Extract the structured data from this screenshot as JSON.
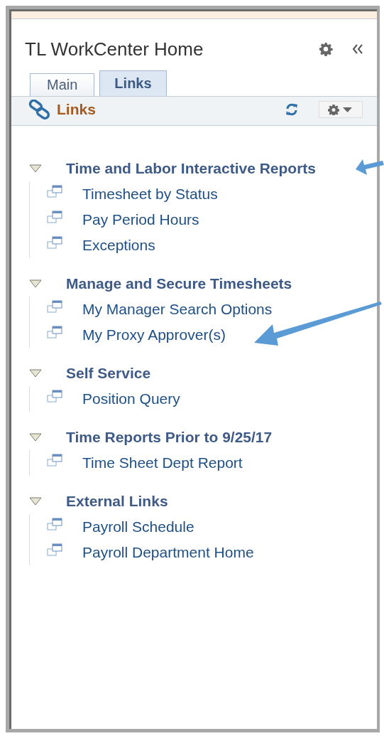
{
  "pagelet": {
    "title": "TL WorkCenter Home"
  },
  "tabs": [
    {
      "label": "Main",
      "selected": false
    },
    {
      "label": "Links",
      "selected": true
    }
  ],
  "links_header": {
    "title": "Links"
  },
  "sections": [
    {
      "title": "Time and Labor Interactive Reports",
      "expanded": true,
      "links": [
        "Timesheet by Status",
        "Pay Period Hours",
        "Exceptions"
      ]
    },
    {
      "title": "Manage and Secure Timesheets",
      "expanded": true,
      "links": [
        "My Manager Search Options",
        "My Proxy Approver(s)"
      ]
    },
    {
      "title": "Self Service",
      "expanded": true,
      "links": [
        "Position Query"
      ]
    },
    {
      "title": "Time Reports Prior to 9/25/17",
      "expanded": true,
      "links": [
        "Time Sheet Dept Report"
      ]
    },
    {
      "title": "External Links",
      "expanded": true,
      "links": [
        "Payroll Schedule",
        "Payroll Department Home"
      ]
    }
  ]
}
